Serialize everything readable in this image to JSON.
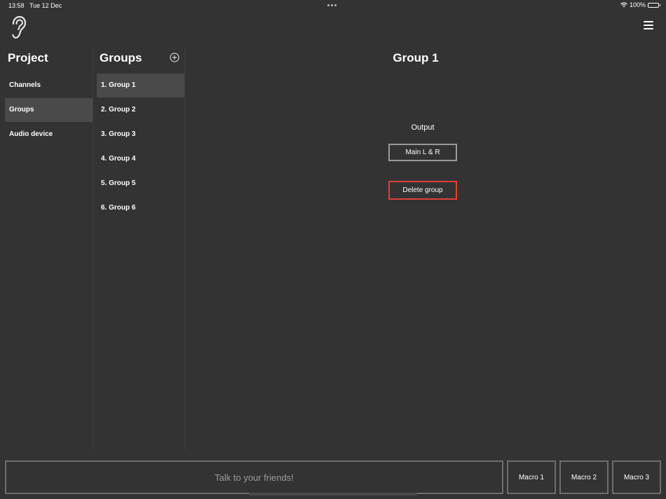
{
  "status_bar": {
    "time": "13:58",
    "date": "Tue 12 Dec",
    "battery": "100%"
  },
  "icons": {
    "logo": "ear-icon",
    "menu": "hamburger-menu-icon",
    "add": "plus-circle-icon"
  },
  "project": {
    "title": "Project",
    "items": [
      {
        "label": "Channels",
        "selected": false
      },
      {
        "label": "Groups",
        "selected": true
      },
      {
        "label": "Audio device",
        "selected": false
      }
    ]
  },
  "groups": {
    "title": "Groups",
    "items": [
      {
        "label": "1. Group 1",
        "selected": true
      },
      {
        "label": "2. Group 2",
        "selected": false
      },
      {
        "label": "3. Group 3",
        "selected": false
      },
      {
        "label": "4. Group 4",
        "selected": false
      },
      {
        "label": "5. Group 5",
        "selected": false
      },
      {
        "label": "6. Group 6",
        "selected": false
      }
    ]
  },
  "detail": {
    "title": "Group 1",
    "output_label": "Output",
    "output_value": "Main L & R",
    "delete_label": "Delete group"
  },
  "bottom_bar": {
    "chat_placeholder": "Talk to your friends!",
    "macros": [
      "Macro 1",
      "Macro 2",
      "Macro 3"
    ]
  },
  "colors": {
    "background": "#333333",
    "selected_item": "#4a4a4a",
    "delete_border": "#e0403a",
    "button_border": "#9a9a9a"
  }
}
